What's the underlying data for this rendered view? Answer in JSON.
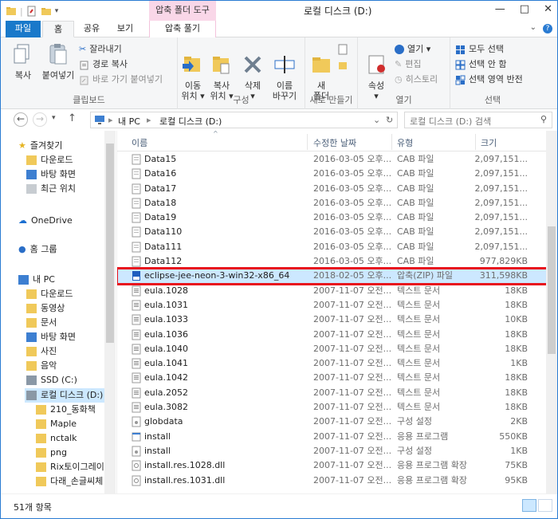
{
  "window": {
    "title": "로컬 디스크 (D:)",
    "contextual_group": "압축 폴더 도구",
    "controls": [
      "—",
      "□",
      "✕"
    ]
  },
  "tabs": {
    "file": "파일",
    "home": "홈",
    "share": "공유",
    "view": "보기",
    "extract": "압축 풀기",
    "help": "?"
  },
  "ribbon": {
    "clipboard": {
      "label": "클립보드",
      "copy": "복사",
      "paste": "붙여넣기",
      "cut": "잘라내기",
      "copy_path": "경로 복사",
      "paste_shortcut": "바로 가기 붙여넣기"
    },
    "organize": {
      "label": "구성",
      "move_to": "이동\n위치 ▾",
      "copy_to": "복사\n위치 ▾",
      "delete": "삭제\n▾",
      "rename": "이름\n바꾸기"
    },
    "new": {
      "label": "새로 만들기",
      "new_folder": "새\n폴더"
    },
    "open": {
      "label": "열기",
      "properties": "속성\n▾",
      "open": "열기 ▾",
      "edit": "편집",
      "history": "히스토리"
    },
    "select": {
      "label": "선택",
      "select_all": "모두 선택",
      "select_none": "선택 안 함",
      "invert": "선택 영역 반전"
    }
  },
  "address": {
    "crumbs": [
      "내 PC",
      "▸",
      "로컬 디스크 (D:)"
    ],
    "search_placeholder": "로컬 디스크 (D:) 검색"
  },
  "nav": {
    "favorites": "즐겨찾기",
    "downloads": "다운로드",
    "desktop": "바탕 화면",
    "recent": "최근 위치",
    "onedrive": "OneDrive",
    "homegroup": "홈 그룹",
    "thispc": "내 PC",
    "pc_downloads": "다운로드",
    "videos": "동영상",
    "documents": "문서",
    "pc_desktop": "바탕 화면",
    "pictures": "사진",
    "music": "음악",
    "ssd": "SSD (C:)",
    "local_d": "로컬 디스크 (D:)",
    "f1": "210_동화책",
    "f2": "Maple",
    "f3": "nctalk",
    "f4": "png",
    "f5": "Rix토이그레이",
    "f6": "다래_손글씨체"
  },
  "columns": {
    "name": "이름",
    "date": "수정한 날짜",
    "type": "유형",
    "size": "크기"
  },
  "files": [
    {
      "name": "Data15",
      "date": "2016-03-05 오후...",
      "type": "CAB 파일",
      "size": "2,097,151...",
      "icon": "cab"
    },
    {
      "name": "Data16",
      "date": "2016-03-05 오후...",
      "type": "CAB 파일",
      "size": "2,097,151...",
      "icon": "cab"
    },
    {
      "name": "Data17",
      "date": "2016-03-05 오후...",
      "type": "CAB 파일",
      "size": "2,097,151...",
      "icon": "cab"
    },
    {
      "name": "Data18",
      "date": "2016-03-05 오후...",
      "type": "CAB 파일",
      "size": "2,097,151...",
      "icon": "cab"
    },
    {
      "name": "Data19",
      "date": "2016-03-05 오후...",
      "type": "CAB 파일",
      "size": "2,097,151...",
      "icon": "cab"
    },
    {
      "name": "Data110",
      "date": "2016-03-05 오후...",
      "type": "CAB 파일",
      "size": "2,097,151...",
      "icon": "cab"
    },
    {
      "name": "Data111",
      "date": "2016-03-05 오후...",
      "type": "CAB 파일",
      "size": "2,097,151...",
      "icon": "cab"
    },
    {
      "name": "Data112",
      "date": "2016-03-05 오후...",
      "type": "CAB 파일",
      "size": "977,829KB",
      "icon": "cab"
    },
    {
      "name": "eclipse-jee-neon-3-win32-x86_64",
      "date": "2018-02-05 오후...",
      "type": "압축(ZIP) 파일",
      "size": "311,598KB",
      "icon": "zip",
      "selected": true
    },
    {
      "name": "eula.1028",
      "date": "2007-11-07 오전...",
      "type": "텍스트 문서",
      "size": "18KB",
      "icon": "txt"
    },
    {
      "name": "eula.1031",
      "date": "2007-11-07 오전...",
      "type": "텍스트 문서",
      "size": "18KB",
      "icon": "txt"
    },
    {
      "name": "eula.1033",
      "date": "2007-11-07 오전...",
      "type": "텍스트 문서",
      "size": "10KB",
      "icon": "txt"
    },
    {
      "name": "eula.1036",
      "date": "2007-11-07 오전...",
      "type": "텍스트 문서",
      "size": "18KB",
      "icon": "txt"
    },
    {
      "name": "eula.1040",
      "date": "2007-11-07 오전...",
      "type": "텍스트 문서",
      "size": "18KB",
      "icon": "txt"
    },
    {
      "name": "eula.1041",
      "date": "2007-11-07 오전...",
      "type": "텍스트 문서",
      "size": "1KB",
      "icon": "txt"
    },
    {
      "name": "eula.1042",
      "date": "2007-11-07 오전...",
      "type": "텍스트 문서",
      "size": "18KB",
      "icon": "txt"
    },
    {
      "name": "eula.2052",
      "date": "2007-11-07 오전...",
      "type": "텍스트 문서",
      "size": "18KB",
      "icon": "txt"
    },
    {
      "name": "eula.3082",
      "date": "2007-11-07 오전...",
      "type": "텍스트 문서",
      "size": "18KB",
      "icon": "txt"
    },
    {
      "name": "globdata",
      "date": "2007-11-07 오전...",
      "type": "구성 설정",
      "size": "2KB",
      "icon": "ini"
    },
    {
      "name": "install",
      "date": "2007-11-07 오전...",
      "type": "응용 프로그램",
      "size": "550KB",
      "icon": "exe"
    },
    {
      "name": "install",
      "date": "2007-11-07 오전...",
      "type": "구성 설정",
      "size": "1KB",
      "icon": "ini"
    },
    {
      "name": "install.res.1028.dll",
      "date": "2007-11-07 오전...",
      "type": "응용 프로그램 확장",
      "size": "75KB",
      "icon": "dll"
    },
    {
      "name": "install.res.1031.dll",
      "date": "2007-11-07 오전...",
      "type": "응용 프로그램 확장",
      "size": "95KB",
      "icon": "dll"
    }
  ],
  "status": {
    "count": "51개 항목"
  }
}
